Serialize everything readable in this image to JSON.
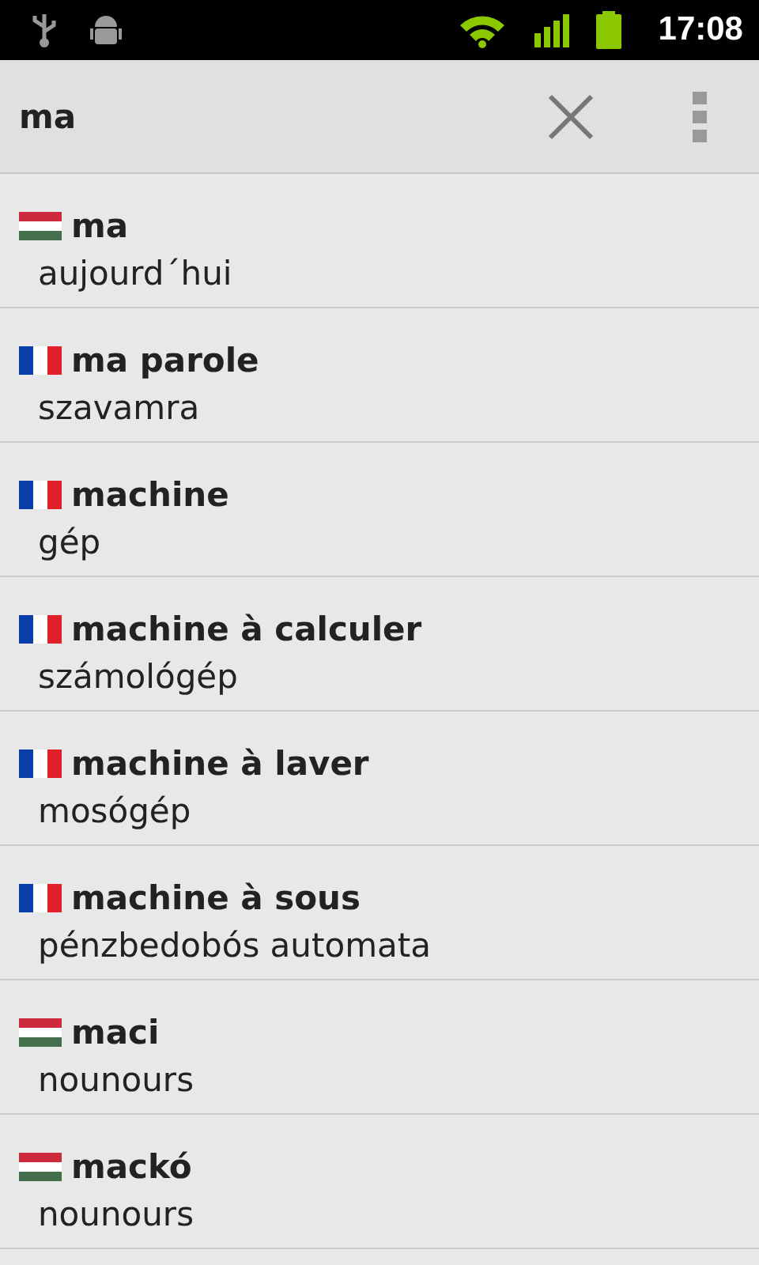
{
  "status_bar": {
    "time": "17:08"
  },
  "search": {
    "value": "ma"
  },
  "entries": [
    {
      "kind": "hungarian",
      "word": "ma",
      "translation": "aujourd´hui"
    },
    {
      "kind": "french",
      "word": "ma parole",
      "translation": "szavamra"
    },
    {
      "kind": "french",
      "word": "machine",
      "translation": "gép"
    },
    {
      "kind": "french",
      "word": "machine à calculer",
      "translation": "számológép"
    },
    {
      "kind": "french",
      "word": "machine à laver",
      "translation": "mosógép"
    },
    {
      "kind": "french",
      "word": "machine à sous",
      "translation": "pénzbedobós automata"
    },
    {
      "kind": "hungarian",
      "word": "maci",
      "translation": "nounours"
    },
    {
      "kind": "hungarian",
      "word": "mackó",
      "translation": "nounours"
    }
  ]
}
